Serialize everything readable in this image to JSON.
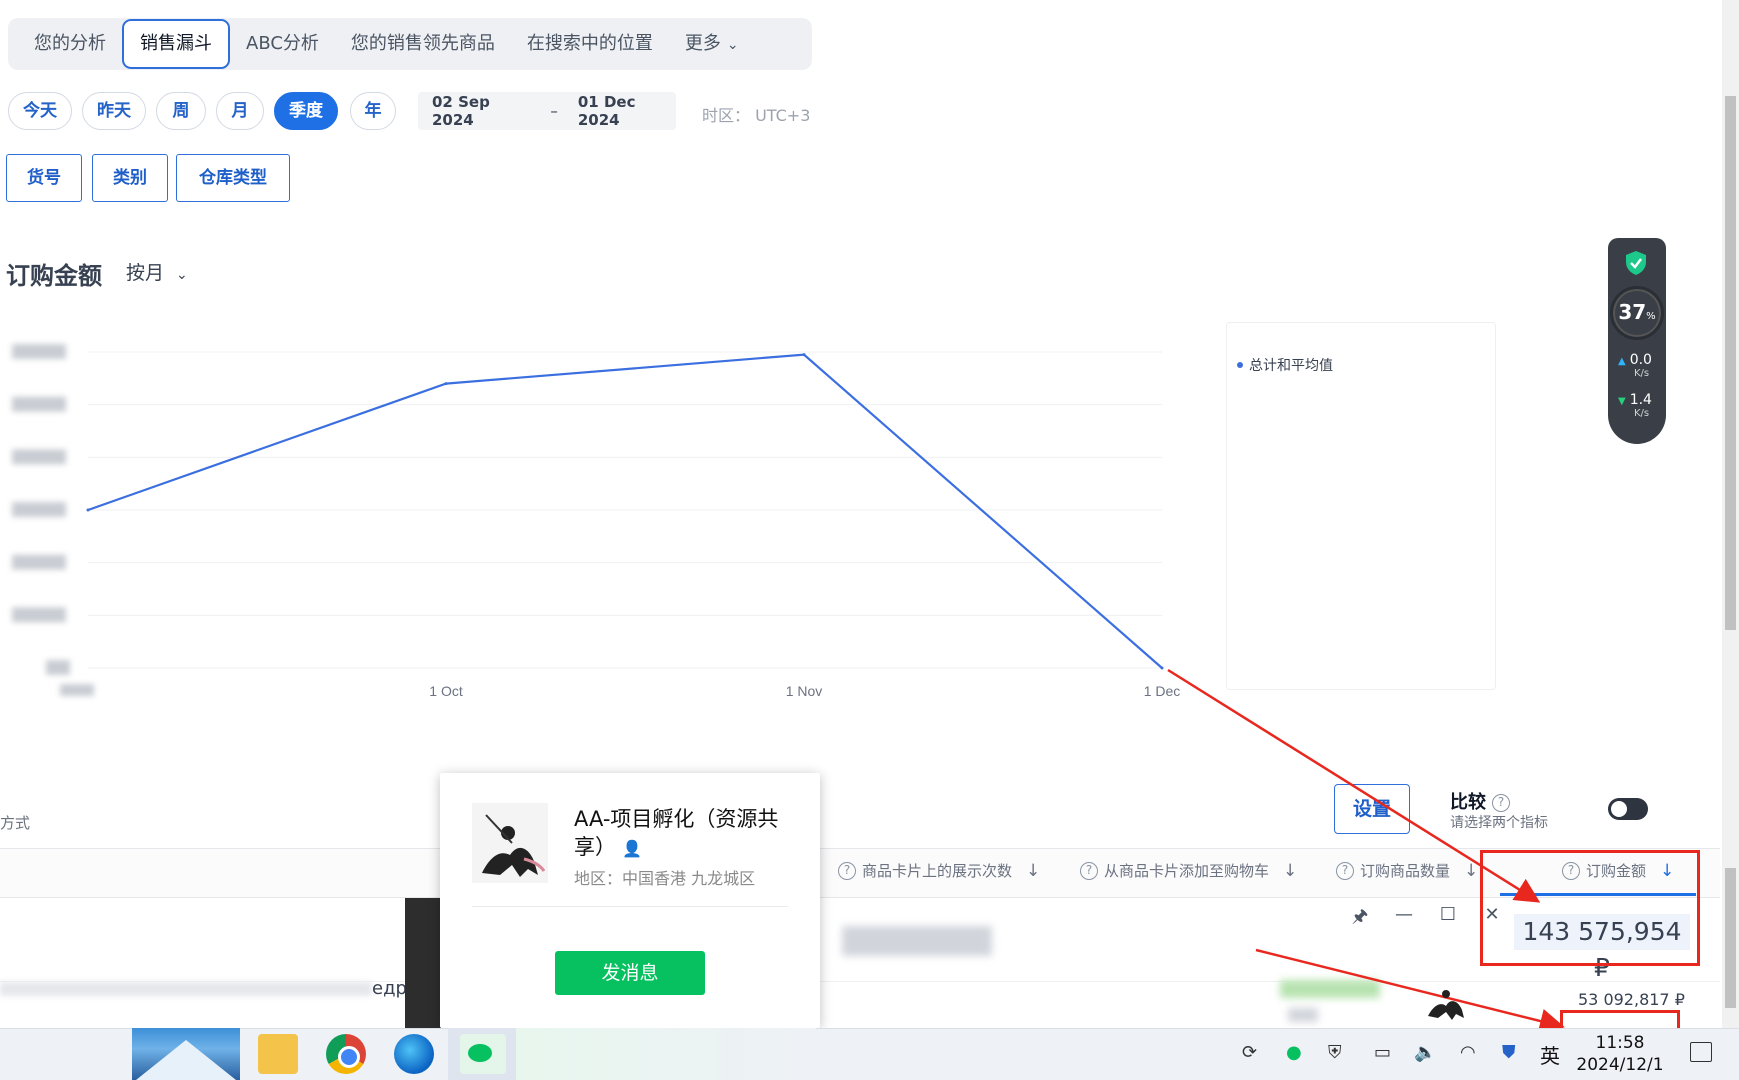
{
  "tabs": [
    {
      "label": "您的分析",
      "active": false
    },
    {
      "label": "销售漏斗",
      "active": true
    },
    {
      "label": "ABC分析",
      "active": false
    },
    {
      "label": "您的销售领先商品",
      "active": false
    },
    {
      "label": "在搜索中的位置",
      "active": false
    },
    {
      "label": "更多",
      "active": false
    }
  ],
  "periods": [
    {
      "label": "今天",
      "active": false
    },
    {
      "label": "昨天",
      "active": false
    },
    {
      "label": "周",
      "active": false
    },
    {
      "label": "月",
      "active": false
    },
    {
      "label": "季度",
      "active": true
    },
    {
      "label": "年",
      "active": false
    }
  ],
  "date_range": {
    "start": "02 Sep 2024",
    "separator": "–",
    "end": "01 Dec 2024"
  },
  "timezone": "时区：  UTC+3",
  "filters": [
    "货号",
    "类别",
    "仓库类型"
  ],
  "chart_section": {
    "title": "订购金额",
    "granularity": "按月"
  },
  "chart_data": {
    "type": "line",
    "title": "订购金额",
    "x": [
      "Sep",
      "1 Oct",
      "1 Nov",
      "1 Dec"
    ],
    "x_tick_labels": [
      "",
      "1 Oct",
      "1 Nov",
      "1 Dec"
    ],
    "series": [
      {
        "name": "总计和平均值",
        "values": [
          3.0,
          5.4,
          5.95,
          0.0
        ],
        "color": "#3b6fe0"
      }
    ],
    "ylim": [
      0,
      6
    ],
    "y_ticks": [
      0,
      1,
      2,
      3,
      4,
      5,
      6
    ],
    "y_tick_labels_blurred": true,
    "grid": true,
    "legend_position": "right"
  },
  "legend": {
    "label": "总计和平均值"
  },
  "net_widget": {
    "percent": "37",
    "percent_unit": "%",
    "upload": "0.0",
    "download": "1.4",
    "unit": "K/s"
  },
  "mode_label": "方式",
  "settings_button": "设置",
  "compare": {
    "title": "比较",
    "help": "?",
    "subtitle": "请选择两个指标"
  },
  "columns": [
    {
      "label": "商品卡片上的展示次数",
      "active": false
    },
    {
      "label": "从商品卡片添加至购物车",
      "active": false
    },
    {
      "label": "订购商品数量",
      "active": false
    },
    {
      "label": "订购金额",
      "active": true
    }
  ],
  "total_amount": "143 575,954 ₽",
  "row_amount": "53 092,817 ₽",
  "row_name_tail": "едр",
  "window_controls": [
    "🖈",
    "—",
    "☐",
    "✕"
  ],
  "popup": {
    "name": "AA-项目孵化（资源共享）",
    "region": "地区：中国香港 九龙城区",
    "button": "发消息"
  },
  "taskbar": {
    "time": "11:58",
    "date": "2024/12/1",
    "ime": "英"
  },
  "colors": {
    "accent": "#1f6fe5",
    "line": "#3b6fe0",
    "annotation": "#e8281f",
    "wechat_green": "#07c160"
  }
}
